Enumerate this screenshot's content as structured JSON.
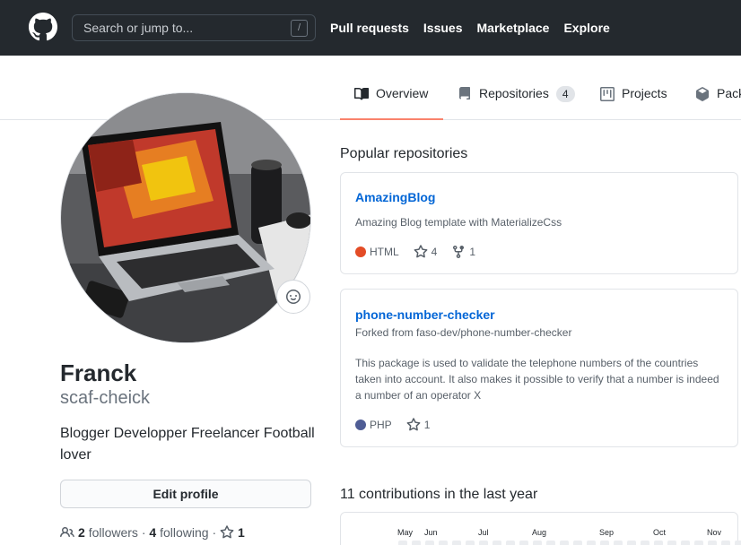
{
  "header": {
    "search_placeholder": "Search or jump to...",
    "search_key": "/",
    "nav": [
      "Pull requests",
      "Issues",
      "Marketplace",
      "Explore"
    ]
  },
  "tabs": [
    {
      "label": "Overview",
      "icon": "book-icon",
      "selected": true
    },
    {
      "label": "Repositories",
      "icon": "repo-icon",
      "count": "4"
    },
    {
      "label": "Projects",
      "icon": "project-icon"
    },
    {
      "label": "Pack",
      "icon": "package-icon"
    }
  ],
  "profile": {
    "name": "Franck",
    "username": "scaf-cheick",
    "bio": "Blogger Developper Freelancer Football lover",
    "edit_label": "Edit profile",
    "followers_count": "2",
    "followers_label": "followers",
    "following_count": "4",
    "following_label": "following",
    "stars_count": "1"
  },
  "popular": {
    "title": "Popular repositories",
    "repos": [
      {
        "name": "AmazingBlog",
        "description": "Amazing Blog template with MaterializeCss",
        "language": "HTML",
        "language_color": "#e34c26",
        "stars": "4",
        "forks": "1"
      },
      {
        "name": "phone-number-checker",
        "forked_from": "Forked from faso-dev/phone-number-checker",
        "description": "This package is used to validate the telephone numbers of the countries taken into account. It also makes it possible to verify that a number is indeed a number of an operator X",
        "language": "PHP",
        "language_color": "#4F5D95",
        "stars": "1"
      }
    ]
  },
  "contributions": {
    "title": "11 contributions in the last year",
    "months": [
      "May",
      "Jun",
      "Jul",
      "Aug",
      "Sep",
      "Oct",
      "Nov"
    ]
  }
}
